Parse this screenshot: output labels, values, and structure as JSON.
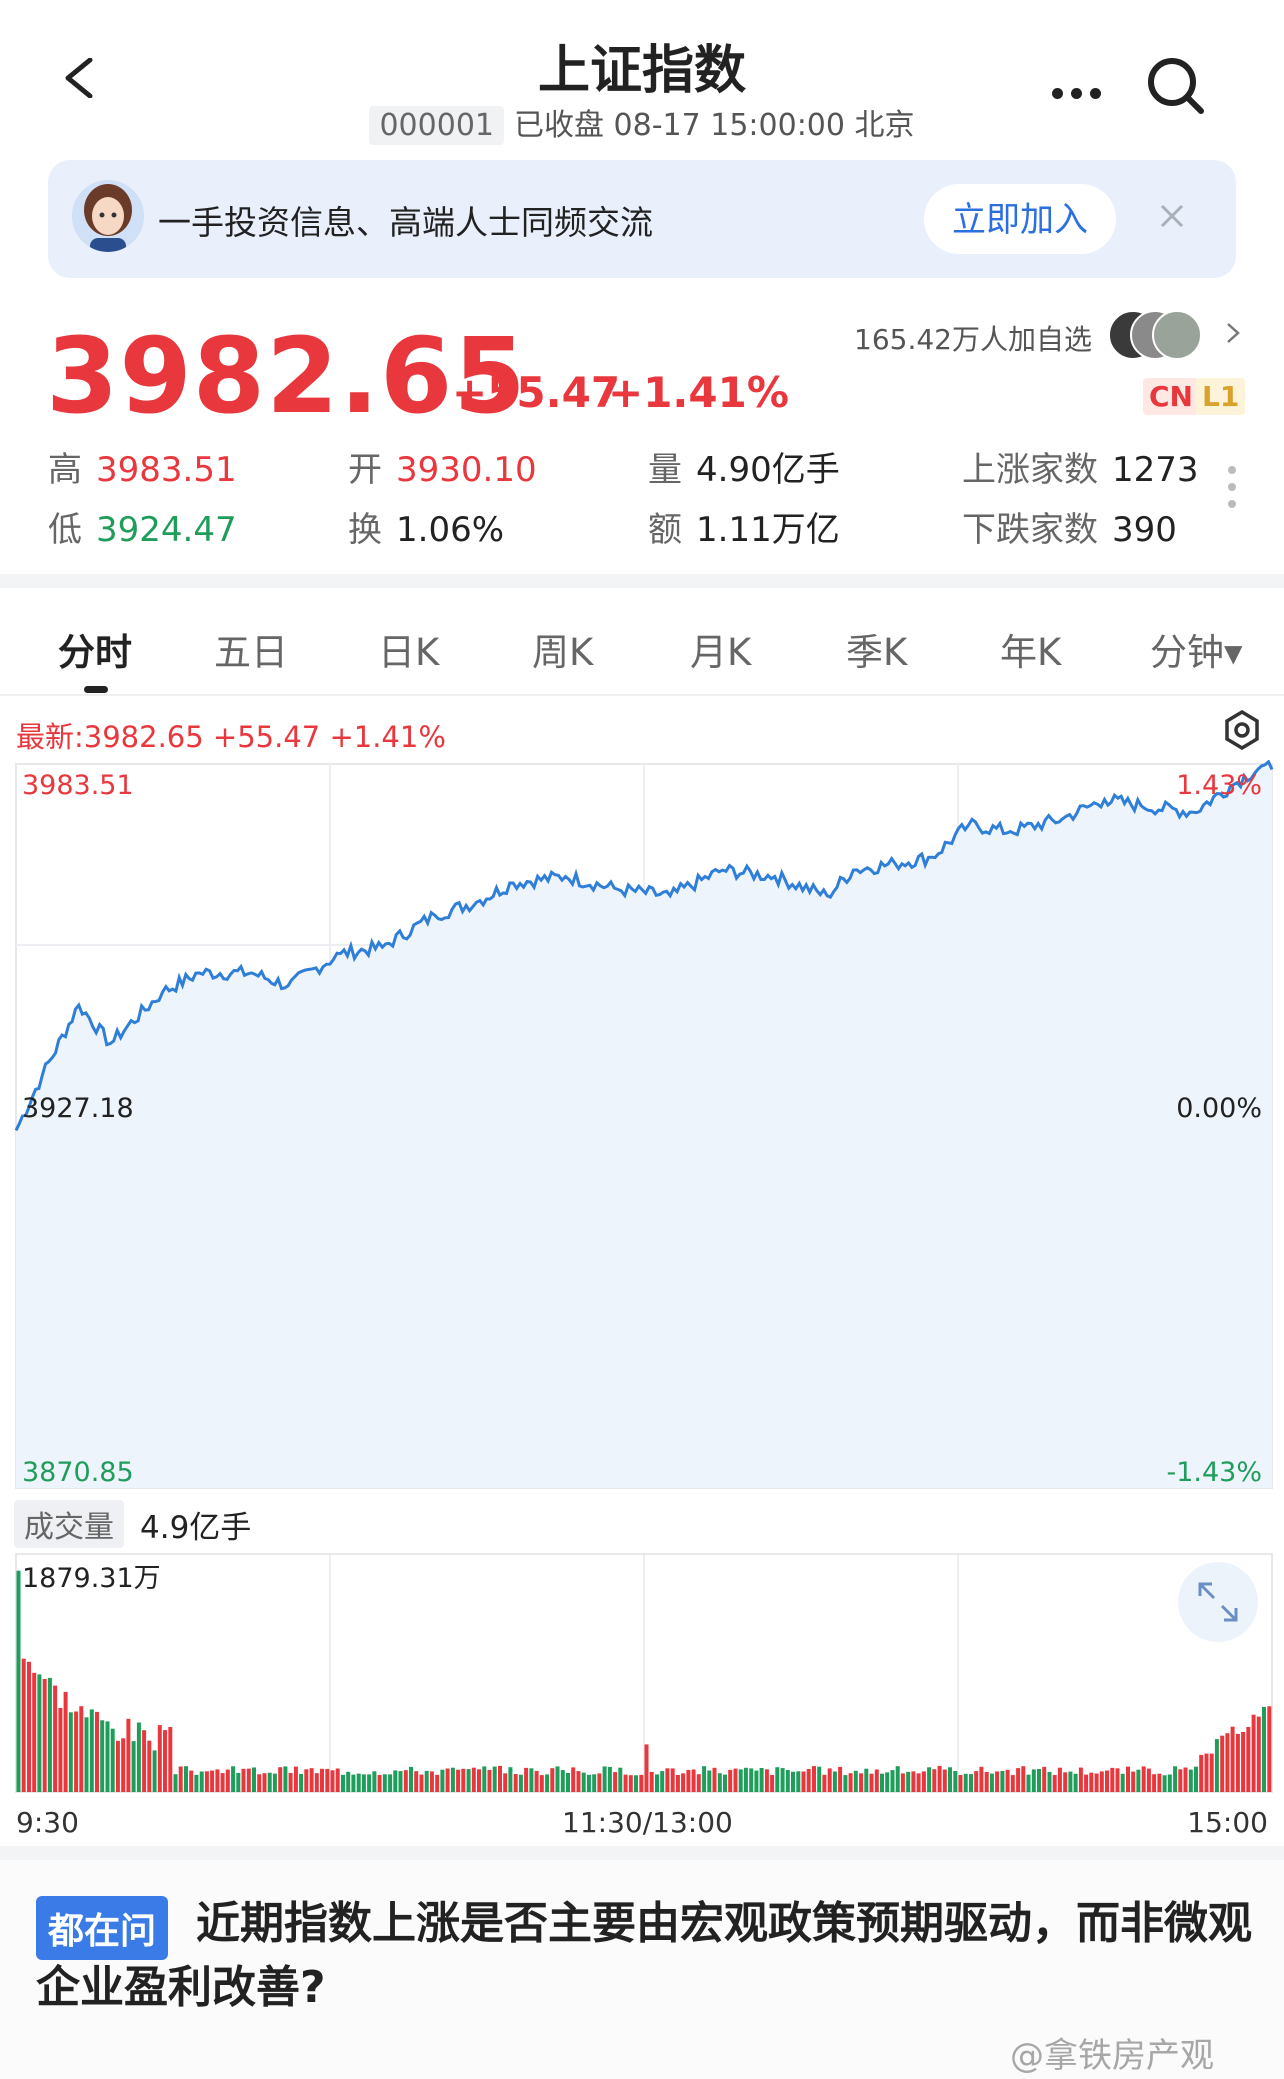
{
  "header": {
    "title": "上证指数",
    "code": "000001",
    "status": "已收盘 08-17 15:00:00 北京"
  },
  "banner": {
    "text": "一手投资信息、高端人士同频交流",
    "join_label": "立即加入"
  },
  "quote": {
    "price": "3982.65",
    "change": "+55.47",
    "change_pct": "+1.41%",
    "watchers": "165.42万人加自选",
    "tag_cn": "CN",
    "tag_l1": "L1",
    "stats": [
      {
        "label": "高",
        "value": "3983.51",
        "tone": "red"
      },
      {
        "label": "开",
        "value": "3930.10",
        "tone": "red"
      },
      {
        "label": "量",
        "value": "4.90亿手",
        "tone": "dark"
      },
      {
        "label": "上涨家数",
        "value": "1273",
        "tone": "dark"
      },
      {
        "label": "低",
        "value": "3924.47",
        "tone": "green"
      },
      {
        "label": "换",
        "value": "1.06%",
        "tone": "dark"
      },
      {
        "label": "额",
        "value": "1.11万亿",
        "tone": "dark"
      },
      {
        "label": "下跌家数",
        "value": "390",
        "tone": "dark"
      }
    ]
  },
  "tabs": [
    {
      "label": "分时",
      "active": true
    },
    {
      "label": "五日"
    },
    {
      "label": "日K"
    },
    {
      "label": "周K"
    },
    {
      "label": "月K"
    },
    {
      "label": "季K"
    },
    {
      "label": "年K"
    },
    {
      "label": "分钟▾"
    }
  ],
  "chart_header": {
    "latest": "最新:3982.65  +55.47  +1.41%"
  },
  "chart_data": [
    {
      "type": "line",
      "series_kind": "intraday-price",
      "yleft_labels": {
        "top": "3983.51",
        "mid": "3927.18",
        "bottom": "3870.85"
      },
      "yright_labels": {
        "top": "1.43%",
        "mid": "0.00%",
        "bottom": "-1.43%"
      },
      "ylim": [
        3870.85,
        3983.51
      ],
      "baseline": 3927.18,
      "xlim": [
        0,
        240
      ],
      "x": [
        0,
        5,
        12,
        18,
        28,
        35,
        45,
        52,
        62,
        70,
        80,
        88,
        95,
        105,
        115,
        125,
        135,
        145,
        155,
        160,
        168,
        175,
        182,
        190,
        200,
        208,
        215,
        225,
        232,
        238,
        240
      ],
      "values": [
        3926.5,
        3935,
        3946,
        3940,
        3948,
        3951,
        3951,
        3949,
        3954,
        3955,
        3960,
        3962,
        3965,
        3966,
        3964,
        3963,
        3967,
        3966,
        3963,
        3967,
        3968,
        3969,
        3974,
        3973,
        3975,
        3978,
        3977,
        3976,
        3980,
        3983.2,
        3982.65
      ],
      "color": "#2f7ed8"
    },
    {
      "type": "bar",
      "series_kind": "volume",
      "max_label": "1879.31万",
      "ylim": [
        0,
        1879.31
      ],
      "x_labels": [
        "9:30",
        "11:30/13:00",
        "15:00"
      ]
    }
  ],
  "volume_header": {
    "tag": "成交量",
    "value": "4.9亿手"
  },
  "question": {
    "tag": "都在问",
    "text": "近期指数上涨是否主要由宏观政策预期驱动，而非微观企业盈利改善?"
  },
  "watermark": "@拿铁房产观",
  "colors": {
    "up": "#e8373d",
    "down": "#1f9d5a",
    "line": "#2f7ed8",
    "accent": "#2b6fe0"
  }
}
